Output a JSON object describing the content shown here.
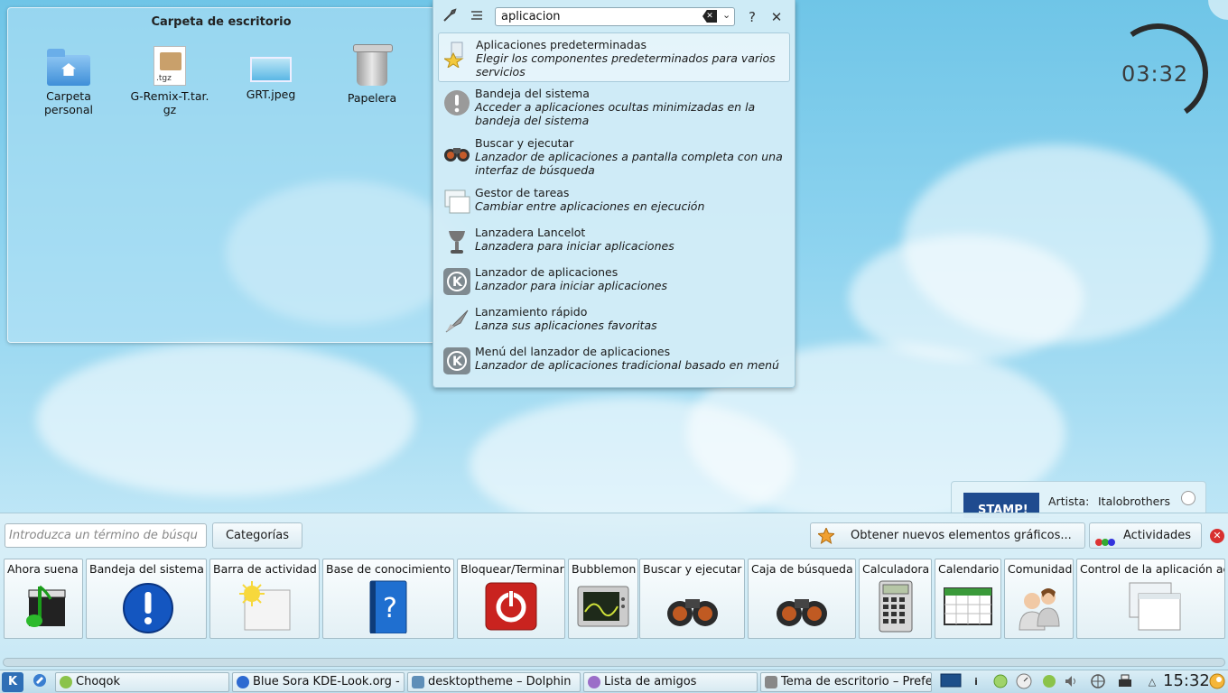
{
  "desktop": {
    "folderview": {
      "title": "Carpeta de escritorio",
      "items": [
        {
          "label": "Carpeta personal",
          "icon": "home-folder-icon"
        },
        {
          "label": "G-Remix-T.tar.gz",
          "icon": "archive-tgz-icon",
          "badge": ".tgz"
        },
        {
          "label": "GRT.jpeg",
          "icon": "image-icon"
        },
        {
          "label": "Papelera",
          "icon": "trash-icon"
        }
      ]
    },
    "clock": {
      "time": "03:32"
    }
  },
  "krunner": {
    "query": "aplicacion",
    "clear_glyph": "✕",
    "dropdown_glyph": "⌄",
    "help_glyph": "?",
    "close_glyph": "✕",
    "results": [
      {
        "name": "Aplicaciones predeterminadas",
        "desc": "Elegir los componentes predeterminados para varios servicios",
        "icon": "star-icon",
        "color": "#f3c93d"
      },
      {
        "name": "Bandeja del sistema",
        "desc": "Acceder a aplicaciones ocultas minimizadas en la bandeja del sistema",
        "icon": "exclamation-icon",
        "color": "#8e8e8e"
      },
      {
        "name": "Buscar y ejecutar",
        "desc": "Lanzador de aplicaciones a pantalla completa con una interfaz de búsqueda",
        "icon": "binoculars-icon",
        "color": "#444444"
      },
      {
        "name": "Gestor de tareas",
        "desc": "Cambiar entre aplicaciones en ejecución",
        "icon": "windows-icon",
        "color": "#dfe9ee"
      },
      {
        "name": "Lanzadera Lancelot",
        "desc": "Lanzadera para iniciar aplicaciones",
        "icon": "chalice-icon",
        "color": "#666666"
      },
      {
        "name": "Lanzador de aplicaciones",
        "desc": "Lanzador para iniciar aplicaciones",
        "icon": "kde-icon",
        "color": "#7f8a90"
      },
      {
        "name": "Lanzamiento rápido",
        "desc": "Lanza sus aplicaciones favoritas",
        "icon": "rocket-icon",
        "color": "#888888"
      },
      {
        "name": "Menú del lanzador de aplicaciones",
        "desc": "Lanzador de aplicaciones tradicional basado en menú",
        "icon": "kde-icon",
        "color": "#7f8a90"
      }
    ]
  },
  "nowplaying": {
    "thumb_text": "STAMP!",
    "label": "Artista:",
    "artist": "Italobrothers"
  },
  "explorer": {
    "search_placeholder": "Introduzca un término de búsqu",
    "categories_label": "Categorías",
    "get_new_label": "Obtener nuevos elementos gráficos...",
    "activities_label": "Actividades",
    "close_glyph": "✕",
    "widgets": [
      {
        "name": "Ahora suena",
        "icon": "music-clapper-icon"
      },
      {
        "name": "Bandeja del sistema",
        "icon": "info-exclamation-icon"
      },
      {
        "name": "Barra de actividad",
        "icon": "activity-bar-icon"
      },
      {
        "name": "Base de conocimiento",
        "icon": "help-book-icon"
      },
      {
        "name": "Bloquear/Terminar",
        "icon": "power-icon"
      },
      {
        "name": "Bubblemon",
        "icon": "monitor-icon"
      },
      {
        "name": "Buscar y ejecutar",
        "icon": "binoculars-icon"
      },
      {
        "name": "Caja de búsqueda",
        "icon": "binoculars-icon"
      },
      {
        "name": "Calculadora",
        "icon": "calculator-icon"
      },
      {
        "name": "Calendario",
        "icon": "calendar-icon"
      },
      {
        "name": "Comunidad",
        "icon": "people-icon"
      },
      {
        "name": "Control de la aplicación activa",
        "icon": "windows-icon"
      }
    ]
  },
  "taskbar": {
    "tasks": [
      {
        "label": "Choqok",
        "icon": "choqok-icon"
      },
      {
        "label": "Blue Sora KDE-Look.org - C",
        "icon": "browser-icon"
      },
      {
        "label": "desktoptheme – Dolphin",
        "icon": "dolphin-icon"
      },
      {
        "label": "Lista de amigos",
        "icon": "pidgin-icon"
      },
      {
        "label": "Tema de escritorio – Prefe",
        "icon": "tools-icon"
      }
    ],
    "time": "15:32"
  }
}
